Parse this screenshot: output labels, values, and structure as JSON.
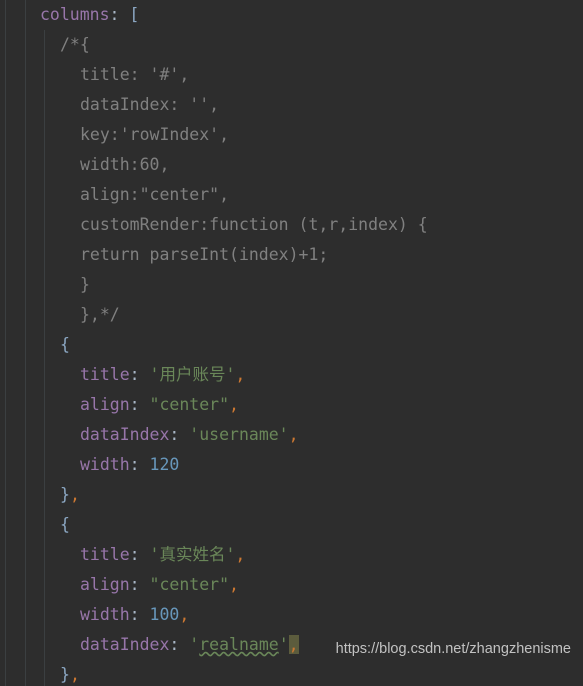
{
  "editor": {
    "theme": "darcula-dark",
    "background_color": "#2d2d2d",
    "colors": {
      "keyword": "#9876aa",
      "punctuation": "#a9b7c6",
      "bracket": "#8ca8c4",
      "string": "#6a8759",
      "number": "#6897bb",
      "comment": "#808080",
      "comma": "#cc7832",
      "selection": "#5c5c3d",
      "indent_guide": "#3b3f41"
    },
    "lines": [
      {
        "indent": 0,
        "tokens": [
          {
            "text": "columns",
            "cls": "t-key"
          },
          {
            "text": ": ",
            "cls": "t-punct"
          },
          {
            "text": "[",
            "cls": "t-bracket"
          }
        ]
      },
      {
        "indent": 1,
        "tokens": [
          {
            "text": "/*{",
            "cls": "t-comment"
          }
        ]
      },
      {
        "indent": 2,
        "tokens": [
          {
            "text": "title: '#',",
            "cls": "t-comment"
          }
        ]
      },
      {
        "indent": 2,
        "tokens": [
          {
            "text": "dataIndex: '',",
            "cls": "t-comment"
          }
        ]
      },
      {
        "indent": 2,
        "tokens": [
          {
            "text": "key:'rowIndex',",
            "cls": "t-comment"
          }
        ]
      },
      {
        "indent": 2,
        "tokens": [
          {
            "text": "width:60,",
            "cls": "t-comment"
          }
        ]
      },
      {
        "indent": 2,
        "tokens": [
          {
            "text": "align:\"center\",",
            "cls": "t-comment"
          }
        ]
      },
      {
        "indent": 2,
        "tokens": [
          {
            "text": "customRender:function (t,r,index) {",
            "cls": "t-comment"
          }
        ]
      },
      {
        "indent": 2,
        "tokens": [
          {
            "text": "return parseInt(index)+1;",
            "cls": "t-comment"
          }
        ]
      },
      {
        "indent": 2,
        "tokens": [
          {
            "text": "}",
            "cls": "t-comment"
          }
        ]
      },
      {
        "indent": 2,
        "tokens": [
          {
            "text": "},*/",
            "cls": "t-comment"
          }
        ]
      },
      {
        "indent": 1,
        "tokens": [
          {
            "text": "{",
            "cls": "t-bracket"
          }
        ]
      },
      {
        "indent": 2,
        "tokens": [
          {
            "text": "title",
            "cls": "t-key"
          },
          {
            "text": ": ",
            "cls": "t-punct"
          },
          {
            "text": "'用户账号'",
            "cls": "t-string"
          },
          {
            "text": ",",
            "cls": "t-comma"
          }
        ]
      },
      {
        "indent": 2,
        "tokens": [
          {
            "text": "align",
            "cls": "t-key"
          },
          {
            "text": ": ",
            "cls": "t-punct"
          },
          {
            "text": "\"center\"",
            "cls": "t-string"
          },
          {
            "text": ",",
            "cls": "t-comma"
          }
        ]
      },
      {
        "indent": 2,
        "tokens": [
          {
            "text": "dataIndex",
            "cls": "t-key"
          },
          {
            "text": ": ",
            "cls": "t-punct"
          },
          {
            "text": "'username'",
            "cls": "t-string"
          },
          {
            "text": ",",
            "cls": "t-comma"
          }
        ]
      },
      {
        "indent": 2,
        "tokens": [
          {
            "text": "width",
            "cls": "t-key"
          },
          {
            "text": ": ",
            "cls": "t-punct"
          },
          {
            "text": "120",
            "cls": "t-number"
          }
        ]
      },
      {
        "indent": 1,
        "tokens": [
          {
            "text": "}",
            "cls": "t-bracket"
          },
          {
            "text": ",",
            "cls": "t-comma"
          }
        ]
      },
      {
        "indent": 1,
        "tokens": [
          {
            "text": "{",
            "cls": "t-bracket"
          }
        ]
      },
      {
        "indent": 2,
        "tokens": [
          {
            "text": "title",
            "cls": "t-key"
          },
          {
            "text": ": ",
            "cls": "t-punct"
          },
          {
            "text": "'真实姓名'",
            "cls": "t-string"
          },
          {
            "text": ",",
            "cls": "t-comma"
          }
        ]
      },
      {
        "indent": 2,
        "tokens": [
          {
            "text": "align",
            "cls": "t-key"
          },
          {
            "text": ": ",
            "cls": "t-punct"
          },
          {
            "text": "\"center\"",
            "cls": "t-string"
          },
          {
            "text": ",",
            "cls": "t-comma"
          }
        ]
      },
      {
        "indent": 2,
        "tokens": [
          {
            "text": "width",
            "cls": "t-key"
          },
          {
            "text": ": ",
            "cls": "t-punct"
          },
          {
            "text": "100",
            "cls": "t-number"
          },
          {
            "text": ",",
            "cls": "t-comma"
          }
        ]
      },
      {
        "indent": 2,
        "tokens": [
          {
            "text": "dataIndex",
            "cls": "t-key"
          },
          {
            "text": ": ",
            "cls": "t-punct"
          },
          {
            "text": "'",
            "cls": "t-string"
          },
          {
            "text": "realname",
            "cls": "t-string t-spell"
          },
          {
            "text": "'",
            "cls": "t-string"
          },
          {
            "text": ",",
            "cls": "t-comma t-selected"
          }
        ]
      },
      {
        "indent": 1,
        "tokens": [
          {
            "text": "}",
            "cls": "t-bracket"
          },
          {
            "text": ",",
            "cls": "t-comma"
          }
        ]
      }
    ]
  },
  "watermark": {
    "text": "https://blog.csdn.net/zhangzhenisme"
  }
}
